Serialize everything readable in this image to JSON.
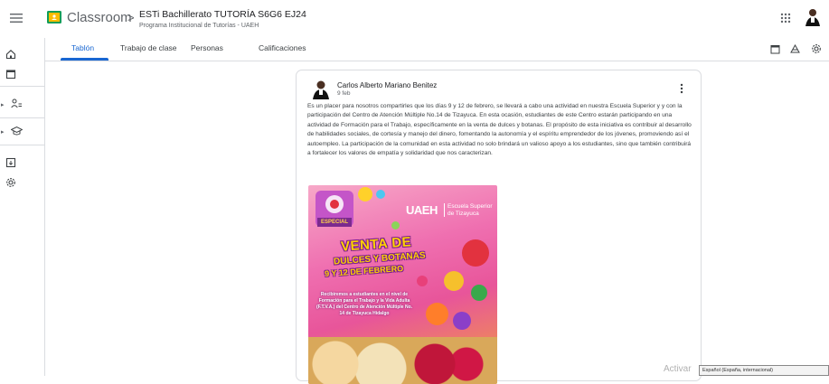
{
  "header": {
    "app_name": "Classroom",
    "class_title": "ESTi Bachillerato TUTORÍA S6G6 EJ24",
    "class_subtitle": "Programa Institucional de Tutorías - UAEH"
  },
  "tabs": [
    {
      "label": "Tablón",
      "active": true
    },
    {
      "label": "Trabajo de clase"
    },
    {
      "label": "Personas"
    },
    {
      "label": "Calificaciones"
    }
  ],
  "post": {
    "author": "Carlos Alberto Mariano Benitez",
    "date": "9 feb",
    "body": "Es un placer para nosotros compartirles que los días 9 y 12 de febrero, se llevará a cabo una actividad en nuestra Escuela Superior y y con la participación del Centro de Atención Múltiple No.14 de Tizayuca. En esta ocasión, estudiantes de este Centro estarán participando en una actividad de Formación para el Trabajo, específicamente en la venta de dulces y botanas. El propósito de esta iniciativa es contribuir al desarrollo de habilidades sociales, de cortesía y manejo del dinero, fomentando la autonomía y el espíritu emprendedor de los jóvenes, promoviendo así el autoempleo. La participación de la comunidad en esta actividad no solo brindará un valioso apoyo a los estudiantes, sino que también contribuirá a fortalecer los valores de empatía y solidaridad que nos caracterizan."
  },
  "flyer": {
    "especial": "ESPECIAL",
    "uaeh": "UAEH",
    "uaeh_sub_1": "Escuela Superior",
    "uaeh_sub_2": "de Tizayuca",
    "venta": "VENTA DE",
    "dulces": "DULCES Y BOTANAS",
    "fechas": "9 Y 12 DE FEBRERO",
    "desc": "Recibiremos a estudiantes en el nivel de Formación para el Trabajo y la Vida Adulta (F.T.V.A.) del Centro de Atención Múltiple No. 14 de Tizayuca Hidalgo"
  },
  "watermark": "Activar",
  "language_tooltip": "Español (España, internacional)",
  "colors": {
    "accent": "#1967d2",
    "border": "#dadce0"
  }
}
